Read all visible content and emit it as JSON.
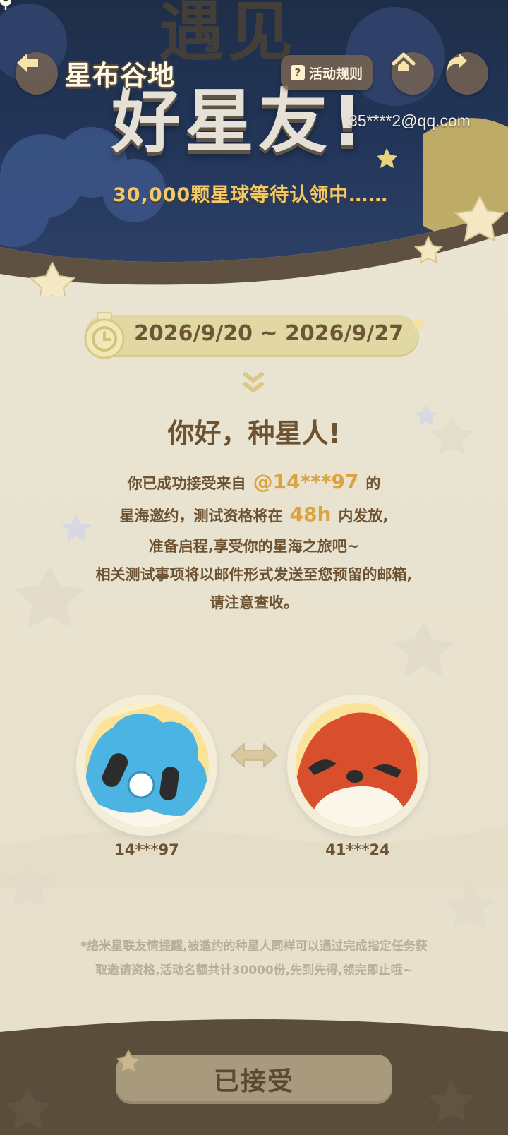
{
  "header": {
    "logo_text": "星布谷地",
    "rules_label": "活动规则",
    "rules_icon": "question-icon",
    "email": "35****2@qq.com"
  },
  "hero": {
    "title_line1": "遇见",
    "title_line2": "好星友!",
    "subtitle": "30,000颗星球等待认领中……"
  },
  "event": {
    "date_range": "2026/9/20 ~ 2026/9/27"
  },
  "greeting": {
    "title": "你好，种星人!",
    "line1_pre": "你已成功接受来自",
    "inviter": "@14***97",
    "line1_post": "的",
    "line2_pre": "星海邀约，测试资格将在",
    "hours": "48h",
    "line2_post": "内发放,",
    "line3": "准备启程,享受你的星海之旅吧~",
    "line4": "相关测试事项将以邮件形式发送至您预留的邮箱,",
    "line5": "请注意查收。"
  },
  "users": {
    "left_name": "14***97",
    "right_name": "41***24"
  },
  "note": {
    "line1": "*络米星联友情提醒,被邀约的种星人同样可以通过完成指定任务获",
    "line2": "取邀请资格,活动名额共计30000份,先到先得,领完即止哦~"
  },
  "footer": {
    "button_label": "已接受"
  },
  "colors": {
    "accent": "#d9a440",
    "text_brown": "#6d5331",
    "button_bg": "#a89a7c",
    "bg": "#ebe5d4"
  }
}
